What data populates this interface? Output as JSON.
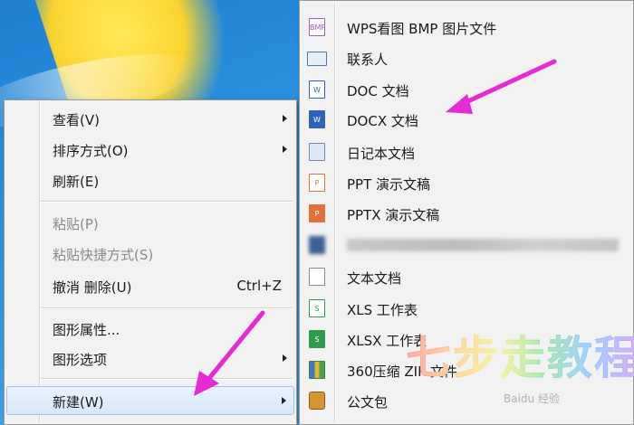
{
  "context_menu": {
    "items": [
      {
        "label": "查看(V)",
        "submenu": true,
        "enabled": true
      },
      {
        "label": "排序方式(O)",
        "submenu": true,
        "enabled": true
      },
      {
        "label": "刷新(E)",
        "submenu": false,
        "enabled": true
      },
      {
        "label": "粘贴(P)",
        "submenu": false,
        "enabled": false
      },
      {
        "label": "粘贴快捷方式(S)",
        "submenu": false,
        "enabled": false
      },
      {
        "label": "撤消 删除(U)",
        "shortcut": "Ctrl+Z",
        "submenu": false,
        "enabled": true
      },
      {
        "label": "图形属性...",
        "submenu": false,
        "enabled": true
      },
      {
        "label": "图形选项",
        "submenu": true,
        "enabled": true
      },
      {
        "label": "新建(W)",
        "submenu": true,
        "enabled": true,
        "highlighted": true
      }
    ]
  },
  "new_submenu": {
    "items": [
      {
        "label": "WPS看图 BMP 图片文件",
        "icon": "bmp-file-icon",
        "icon_text": "BMP"
      },
      {
        "label": "联系人",
        "icon": "contact-card-icon"
      },
      {
        "label": "DOC 文档",
        "icon": "doc-file-icon",
        "icon_text": "W"
      },
      {
        "label": "DOCX 文档",
        "icon": "docx-file-icon",
        "icon_text": "W"
      },
      {
        "label": "日记本文档",
        "icon": "journal-file-icon"
      },
      {
        "label": "PPT 演示文稿",
        "icon": "ppt-file-icon",
        "icon_text": "P"
      },
      {
        "label": "PPTX 演示文稿",
        "icon": "pptx-file-icon",
        "icon_text": "P"
      },
      {
        "label": "",
        "icon": "blurred-file-icon",
        "blurred": true
      },
      {
        "label": "文本文档",
        "icon": "text-file-icon"
      },
      {
        "label": "XLS 工作表",
        "icon": "xls-file-icon",
        "icon_text": "S"
      },
      {
        "label": "XLSX 工作表",
        "icon": "xlsx-file-icon",
        "icon_text": "S"
      },
      {
        "label": "360压缩 ZIP 文件",
        "icon": "zip-archive-icon"
      },
      {
        "label": "公文包",
        "icon": "briefcase-icon"
      }
    ]
  },
  "watermark": {
    "text": "七步走教程",
    "sub": "Baidu 经验"
  },
  "colors": {
    "menu_bg": "#f2f2f2",
    "highlight": "#d6e8fb",
    "annotation_arrow": "#e52ad6",
    "desktop": "#2d98e6"
  }
}
